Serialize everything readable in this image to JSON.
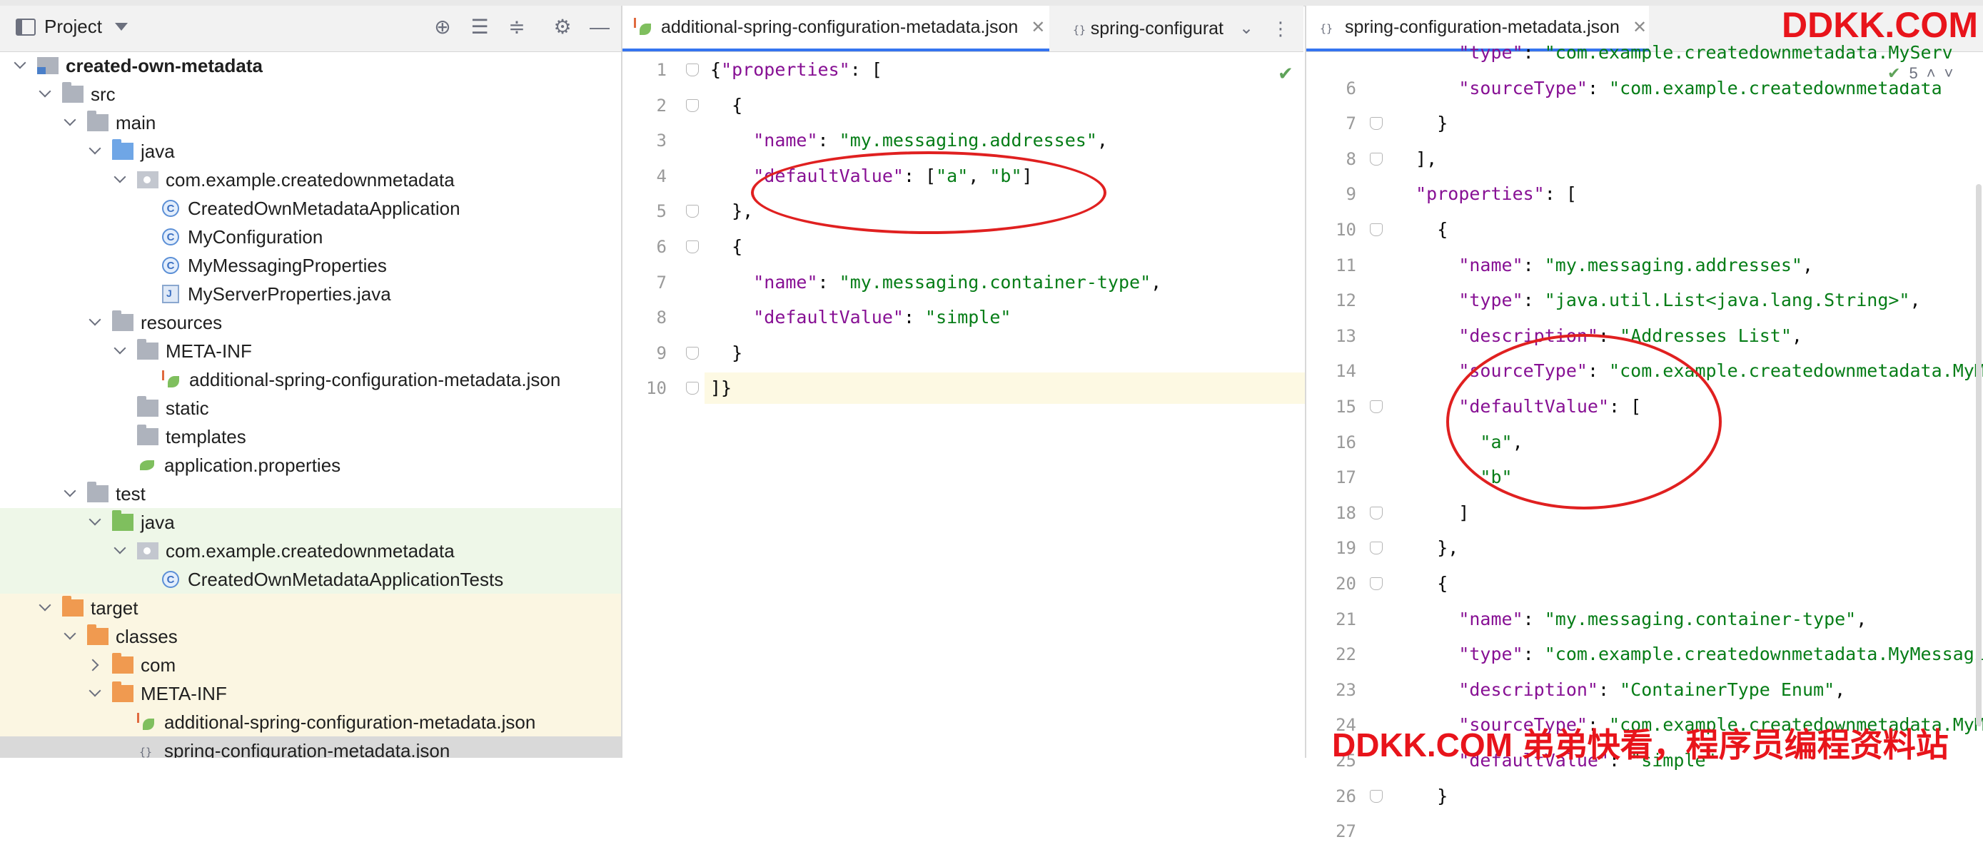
{
  "project_panel": {
    "title": "Project",
    "tree": [
      {
        "label": "created-own-metadata",
        "indent": 0,
        "expand": "down",
        "icon": "module-folder",
        "bold": true,
        "bg": ""
      },
      {
        "label": "src",
        "indent": 1,
        "expand": "down",
        "icon": "folder-gray",
        "bg": ""
      },
      {
        "label": "main",
        "indent": 2,
        "expand": "down",
        "icon": "folder-gray",
        "bg": ""
      },
      {
        "label": "java",
        "indent": 3,
        "expand": "down",
        "icon": "folder-blue",
        "bg": ""
      },
      {
        "label": "com.example.createdownmetadata",
        "indent": 4,
        "expand": "down",
        "icon": "package",
        "bg": ""
      },
      {
        "label": "CreatedOwnMetadataApplication",
        "indent": 5,
        "expand": "none",
        "icon": "spring-class",
        "bg": ""
      },
      {
        "label": "MyConfiguration",
        "indent": 5,
        "expand": "none",
        "icon": "class",
        "bg": ""
      },
      {
        "label": "MyMessagingProperties",
        "indent": 5,
        "expand": "none",
        "icon": "class",
        "bg": ""
      },
      {
        "label": "MyServerProperties.java",
        "indent": 5,
        "expand": "none",
        "icon": "java-file",
        "bg": ""
      },
      {
        "label": "resources",
        "indent": 3,
        "expand": "down",
        "icon": "resources-folder",
        "bg": ""
      },
      {
        "label": "META-INF",
        "indent": 4,
        "expand": "down",
        "icon": "folder-gray",
        "bg": ""
      },
      {
        "label": "additional-spring-configuration-metadata.json",
        "indent": 5,
        "expand": "none",
        "icon": "spring-json",
        "bg": ""
      },
      {
        "label": "static",
        "indent": 4,
        "expand": "none",
        "icon": "folder-gray",
        "bg": ""
      },
      {
        "label": "templates",
        "indent": 4,
        "expand": "none",
        "icon": "folder-gray",
        "bg": ""
      },
      {
        "label": "application.properties",
        "indent": 4,
        "expand": "none",
        "icon": "spring-properties",
        "bg": ""
      },
      {
        "label": "test",
        "indent": 2,
        "expand": "down",
        "icon": "folder-gray",
        "bg": ""
      },
      {
        "label": "java",
        "indent": 3,
        "expand": "down",
        "icon": "folder-green",
        "bg": "test"
      },
      {
        "label": "com.example.createdownmetadata",
        "indent": 4,
        "expand": "down",
        "icon": "package",
        "bg": "test"
      },
      {
        "label": "CreatedOwnMetadataApplicationTests",
        "indent": 5,
        "expand": "none",
        "icon": "spring-class",
        "bg": "test"
      },
      {
        "label": "target",
        "indent": 1,
        "expand": "down",
        "icon": "folder-orange",
        "bg": "target"
      },
      {
        "label": "classes",
        "indent": 2,
        "expand": "down",
        "icon": "folder-orange",
        "bg": "target"
      },
      {
        "label": "com",
        "indent": 3,
        "expand": "right",
        "icon": "folder-orange",
        "bg": "target"
      },
      {
        "label": "META-INF",
        "indent": 3,
        "expand": "down",
        "icon": "folder-orange",
        "bg": "target"
      },
      {
        "label": "additional-spring-configuration-metadata.json",
        "indent": 4,
        "expand": "none",
        "icon": "spring-json",
        "bg": "target"
      },
      {
        "label": "spring-configuration-metadata.json",
        "indent": 4,
        "expand": "none",
        "icon": "json-file",
        "bg": "selected"
      }
    ]
  },
  "editor_left": {
    "tabs": [
      {
        "label": "additional-spring-configuration-metadata.json",
        "active": true
      },
      {
        "label": "spring-configurat",
        "active": false
      }
    ],
    "lines": [
      {
        "n": "1",
        "tokens": [
          [
            "p",
            "{"
          ],
          [
            "k",
            "\"properties\""
          ],
          [
            "p",
            ": ["
          ]
        ]
      },
      {
        "n": "2",
        "tokens": [
          [
            "p",
            "  {"
          ]
        ]
      },
      {
        "n": "3",
        "tokens": [
          [
            "p",
            "    "
          ],
          [
            "k",
            "\"name\""
          ],
          [
            "p",
            ": "
          ],
          [
            "s",
            "\"my.messaging.addresses\""
          ],
          [
            "p",
            ","
          ]
        ]
      },
      {
        "n": "4",
        "tokens": [
          [
            "p",
            "    "
          ],
          [
            "k",
            "\"defaultValue\""
          ],
          [
            "p",
            ": ["
          ],
          [
            "s",
            "\"a\""
          ],
          [
            "p",
            ", "
          ],
          [
            "s",
            "\"b\""
          ],
          [
            "p",
            "]"
          ]
        ]
      },
      {
        "n": "5",
        "tokens": [
          [
            "p",
            "  },"
          ]
        ]
      },
      {
        "n": "6",
        "tokens": [
          [
            "p",
            "  {"
          ]
        ]
      },
      {
        "n": "7",
        "tokens": [
          [
            "p",
            "    "
          ],
          [
            "k",
            "\"name\""
          ],
          [
            "p",
            ": "
          ],
          [
            "s",
            "\"my.messaging.container-type\""
          ],
          [
            "p",
            ","
          ]
        ]
      },
      {
        "n": "8",
        "tokens": [
          [
            "p",
            "    "
          ],
          [
            "k",
            "\"defaultValue\""
          ],
          [
            "p",
            ": "
          ],
          [
            "s",
            "\"simple\""
          ]
        ]
      },
      {
        "n": "9",
        "tokens": [
          [
            "p",
            "  }"
          ]
        ]
      },
      {
        "n": "10",
        "tokens": [
          [
            "p",
            "]}"
          ]
        ]
      }
    ]
  },
  "editor_right": {
    "tab": "spring-configuration-metadata.json",
    "inspection_count": "5",
    "lines": [
      {
        "n": "",
        "tokens": [
          [
            "p",
            "      "
          ],
          [
            "k",
            "\"type\""
          ],
          [
            "p",
            ": "
          ],
          [
            "s",
            "\"com.example.createdownmetadata.MyServ"
          ]
        ]
      },
      {
        "n": "6",
        "tokens": [
          [
            "p",
            "      "
          ],
          [
            "k",
            "\"sourceType\""
          ],
          [
            "p",
            ": "
          ],
          [
            "s",
            "\"com.example.createdownmetadata"
          ]
        ]
      },
      {
        "n": "7",
        "tokens": [
          [
            "p",
            "    }"
          ]
        ]
      },
      {
        "n": "8",
        "tokens": [
          [
            "p",
            "  ],"
          ]
        ]
      },
      {
        "n": "9",
        "tokens": [
          [
            "p",
            "  "
          ],
          [
            "k",
            "\"properties\""
          ],
          [
            "p",
            ": ["
          ]
        ]
      },
      {
        "n": "10",
        "tokens": [
          [
            "p",
            "    {"
          ]
        ]
      },
      {
        "n": "11",
        "tokens": [
          [
            "p",
            "      "
          ],
          [
            "k",
            "\"name\""
          ],
          [
            "p",
            ": "
          ],
          [
            "s",
            "\"my.messaging.addresses\""
          ],
          [
            "p",
            ","
          ]
        ]
      },
      {
        "n": "12",
        "tokens": [
          [
            "p",
            "      "
          ],
          [
            "k",
            "\"type\""
          ],
          [
            "p",
            ": "
          ],
          [
            "s",
            "\"java.util.List<java.lang.String>\""
          ],
          [
            "p",
            ","
          ]
        ]
      },
      {
        "n": "13",
        "tokens": [
          [
            "p",
            "      "
          ],
          [
            "k",
            "\"description\""
          ],
          [
            "p",
            ": "
          ],
          [
            "s",
            "\"Addresses List\""
          ],
          [
            "p",
            ","
          ]
        ]
      },
      {
        "n": "14",
        "tokens": [
          [
            "p",
            "      "
          ],
          [
            "k",
            "\"sourceType\""
          ],
          [
            "p",
            ": "
          ],
          [
            "s",
            "\"com.example.createdownmetadata.MyMess"
          ]
        ]
      },
      {
        "n": "15",
        "tokens": [
          [
            "p",
            "      "
          ],
          [
            "k",
            "\"defaultValue\""
          ],
          [
            "p",
            ": ["
          ]
        ]
      },
      {
        "n": "16",
        "tokens": [
          [
            "p",
            "        "
          ],
          [
            "s",
            "\"a\""
          ],
          [
            "p",
            ","
          ]
        ]
      },
      {
        "n": "17",
        "tokens": [
          [
            "p",
            "        "
          ],
          [
            "s",
            "\"b\""
          ]
        ]
      },
      {
        "n": "18",
        "tokens": [
          [
            "p",
            "      ]"
          ]
        ]
      },
      {
        "n": "19",
        "tokens": [
          [
            "p",
            "    },"
          ]
        ]
      },
      {
        "n": "20",
        "tokens": [
          [
            "p",
            "    {"
          ]
        ]
      },
      {
        "n": "21",
        "tokens": [
          [
            "p",
            "      "
          ],
          [
            "k",
            "\"name\""
          ],
          [
            "p",
            ": "
          ],
          [
            "s",
            "\"my.messaging.container-type\""
          ],
          [
            "p",
            ","
          ]
        ]
      },
      {
        "n": "22",
        "tokens": [
          [
            "p",
            "      "
          ],
          [
            "k",
            "\"type\""
          ],
          [
            "p",
            ": "
          ],
          [
            "s",
            "\"com.example.createdownmetadata.MyMessagi"
          ]
        ]
      },
      {
        "n": "23",
        "tokens": [
          [
            "p",
            "      "
          ],
          [
            "k",
            "\"description\""
          ],
          [
            "p",
            ": "
          ],
          [
            "s",
            "\"ContainerType Enum\""
          ],
          [
            "p",
            ","
          ]
        ]
      },
      {
        "n": "24",
        "tokens": [
          [
            "p",
            "      "
          ],
          [
            "k",
            "\"sourceType\""
          ],
          [
            "p",
            ": "
          ],
          [
            "s",
            "\"com.example.createdownmetadata.MyMess"
          ]
        ]
      },
      {
        "n": "25",
        "tokens": [
          [
            "p",
            "      "
          ],
          [
            "k",
            "\"defaultValue\""
          ],
          [
            "p",
            ": "
          ],
          [
            "s",
            "\"simple\""
          ]
        ]
      },
      {
        "n": "26",
        "tokens": [
          [
            "p",
            "    }"
          ]
        ]
      },
      {
        "n": "27",
        "tokens": []
      }
    ]
  },
  "watermark": {
    "top": "DDKK.COM",
    "bottom": "DDKK.COM 弟弟快看，程序员编程资料站"
  },
  "colors": {
    "key": "#871094",
    "string": "#067d17",
    "punct": "#080808",
    "annotation": "#e02020",
    "watermark": "#e8141b"
  }
}
